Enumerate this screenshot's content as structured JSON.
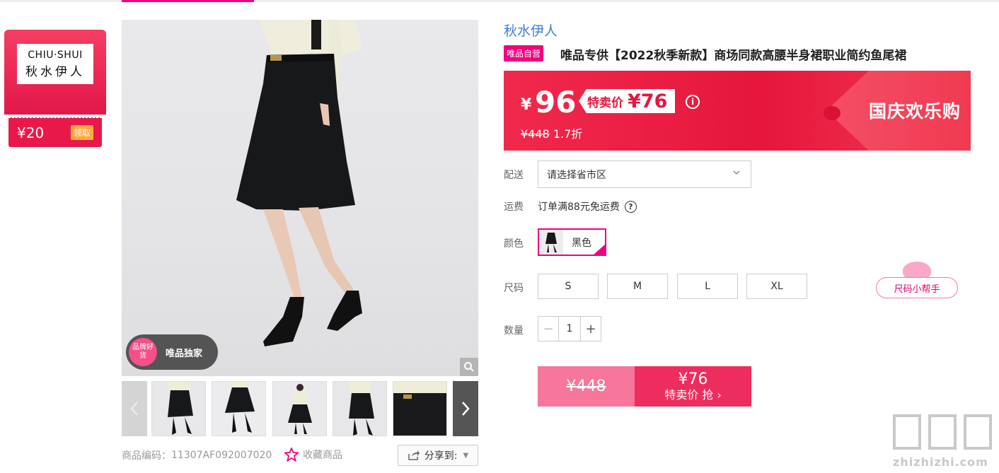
{
  "coupon": {
    "brand_en": "CHIU·SHUI",
    "brand_cn": "秋水伊人",
    "amount": "¥20",
    "claim_label": "领取"
  },
  "gallery": {
    "badge_circle_text": "品牌好货",
    "badge_text": "唯品独家",
    "product_code_label": "商品编码：",
    "product_code": "11307AF092007020",
    "favorite_label": "收藏商品",
    "share_label": "分享到:"
  },
  "product": {
    "brand_link": "秋水伊人",
    "tag": "唯品自营",
    "title": "唯品专供【2022秋季新款】商场同款高腰半身裙职业简约鱼尾裙"
  },
  "price": {
    "currency": "¥",
    "main": "96",
    "special_label": "特卖价",
    "special_amount": "¥76",
    "original": "¥448",
    "discount": "1.7折",
    "event": "国庆欢乐购"
  },
  "options": {
    "delivery_label": "配送",
    "delivery_placeholder": "请选择省市区",
    "shipping_label": "运费",
    "shipping_text": "订单满88元免运费",
    "color_label": "颜色",
    "color_selected": "黑色",
    "size_label": "尺码",
    "sizes": [
      "S",
      "M",
      "L",
      "XL"
    ],
    "size_helper": "尺码小帮手",
    "qty_label": "数量",
    "qty_value": "1"
  },
  "buy": {
    "original": "¥448",
    "price": "¥76",
    "action": "特卖价 抢 ›"
  },
  "watermark": {
    "text": "zhizhizhi.com"
  },
  "colors": {
    "accent": "#f10180",
    "banner_red": "#e6163c",
    "link_blue": "#3a7fd5"
  }
}
